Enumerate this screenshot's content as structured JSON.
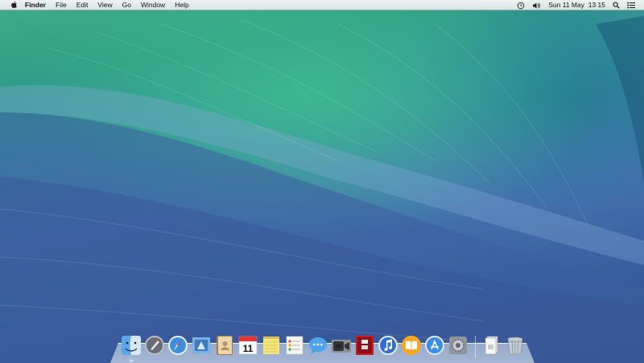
{
  "menubar": {
    "apple_icon": "apple-logo-icon",
    "items": [
      {
        "label": "Finder",
        "bold": true
      },
      {
        "label": "File"
      },
      {
        "label": "Edit"
      },
      {
        "label": "View"
      },
      {
        "label": "Go"
      },
      {
        "label": "Window"
      },
      {
        "label": "Help"
      }
    ],
    "status": {
      "time_machine_icon": "time-machine-icon",
      "volume_icon": "volume-icon",
      "clock": "Sun 11 May  13 15",
      "spotlight_icon": "spotlight-search-icon",
      "notification_icon": "notification-center-icon"
    }
  },
  "dock": {
    "apps": [
      {
        "name": "Finder",
        "icon": "finder-icon",
        "running": true
      },
      {
        "name": "Launchpad",
        "icon": "launchpad-icon"
      },
      {
        "name": "Safari",
        "icon": "safari-icon"
      },
      {
        "name": "Mail",
        "icon": "mail-icon"
      },
      {
        "name": "Contacts",
        "icon": "contacts-icon"
      },
      {
        "name": "Calendar",
        "icon": "calendar-icon",
        "text": "11"
      },
      {
        "name": "Notes",
        "icon": "notes-icon"
      },
      {
        "name": "Reminders",
        "icon": "reminders-icon"
      },
      {
        "name": "Messages",
        "icon": "messages-icon"
      },
      {
        "name": "FaceTime",
        "icon": "facetime-icon"
      },
      {
        "name": "Photo Booth",
        "icon": "photo-booth-icon"
      },
      {
        "name": "iTunes",
        "icon": "itunes-icon"
      },
      {
        "name": "iBooks",
        "icon": "ibooks-icon"
      },
      {
        "name": "App Store",
        "icon": "app-store-icon"
      },
      {
        "name": "System Preferences",
        "icon": "system-preferences-icon"
      }
    ],
    "others": [
      {
        "name": "Documents",
        "icon": "documents-stack-icon"
      },
      {
        "name": "Trash",
        "icon": "trash-icon"
      }
    ]
  }
}
